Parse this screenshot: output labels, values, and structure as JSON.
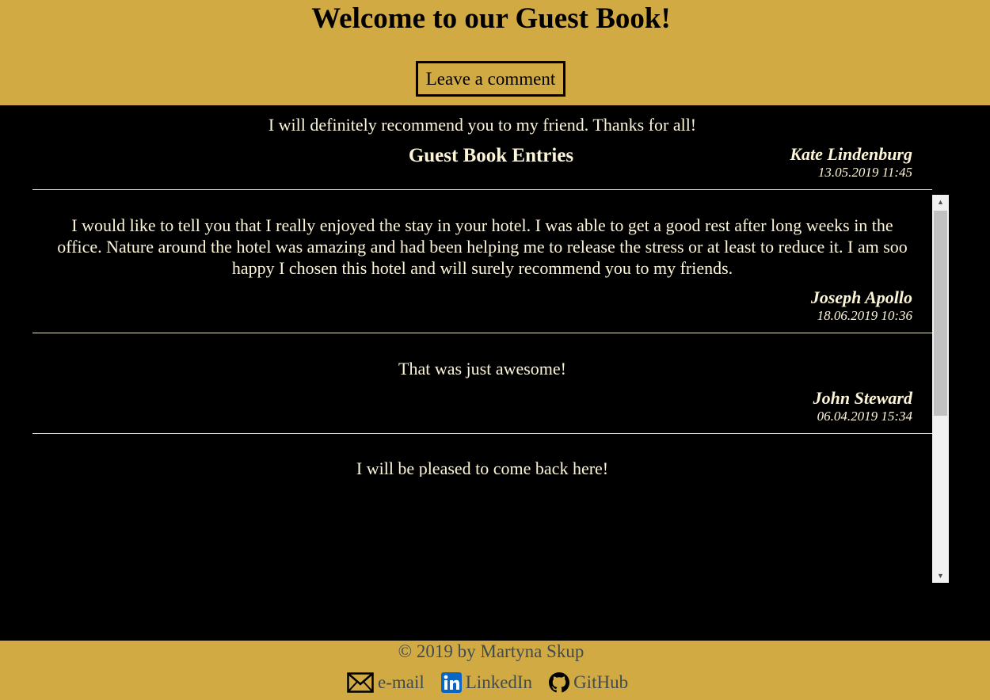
{
  "header": {
    "title": "Welcome to our Guest Book!",
    "leave_comment_label": "Leave a comment",
    "bg_color": "#d2aa43"
  },
  "main": {
    "heading": "Guest Book Entries",
    "entries": [
      {
        "message": "I will definitely recommend you to my friend. Thanks for all!",
        "author": "Kate Lindenburg",
        "date": "13.05.2019 11:45"
      },
      {
        "message": "I would like to tell you that I really enjoyed the stay in your hotel. I was able to get a good rest after long weeks in the office. Nature around the hotel was amazing and had been helping me to release the stress or at least to reduce it. I am soo happy I chosen this hotel and will surely recommend you to my friends.",
        "author": "Joseph Apollo",
        "date": "18.06.2019 10:36"
      },
      {
        "message": "That was just awesome!",
        "author": "John Steward",
        "date": "06.04.2019 15:34"
      },
      {
        "message": "I will be pleased to come back here!",
        "author": "",
        "date": ""
      }
    ]
  },
  "footer": {
    "copyright": "© 2019 by Martyna Skup",
    "links": [
      {
        "label": "e-mail",
        "icon": "envelope-icon"
      },
      {
        "label": "LinkedIn",
        "icon": "linkedin-icon"
      },
      {
        "label": "GitHub",
        "icon": "github-icon"
      }
    ]
  }
}
